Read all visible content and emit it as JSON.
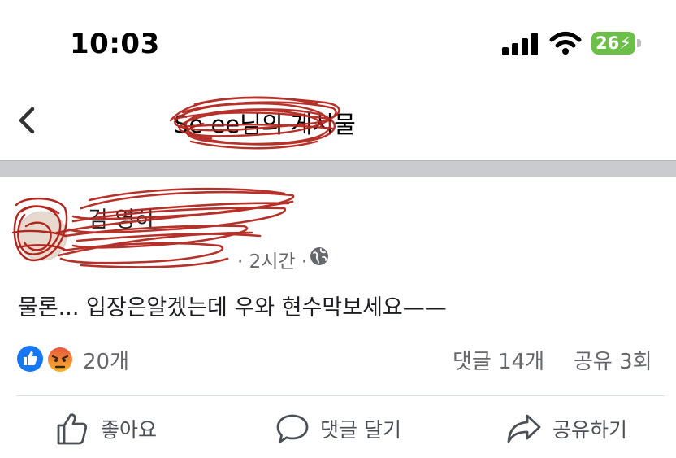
{
  "status_bar": {
    "time": "10:03",
    "battery": "26"
  },
  "header": {
    "title": "Se  ee님의 게시물"
  },
  "post": {
    "author_name": "김  영하",
    "time_ago": "· 2시간 ·",
    "text": "물론... 입장은알겠는데 우와 현수막보세요——"
  },
  "stats": {
    "reactions": "20개",
    "comments": "댓글 14개",
    "shares": "공유 3회"
  },
  "actions": {
    "like": "좋아요",
    "comment": "댓글 달기",
    "share": "공유하기"
  },
  "colors": {
    "like_blue": "#1877f2",
    "redaction": "#b3261e",
    "muted_text": "#65676b"
  },
  "icons": [
    "back-chevron-icon",
    "signal-icon",
    "wifi-icon",
    "battery-icon",
    "globe-icon",
    "like-reaction-icon",
    "angry-reaction-icon",
    "thumbs-up-icon",
    "comment-bubble-icon",
    "share-arrow-icon"
  ]
}
